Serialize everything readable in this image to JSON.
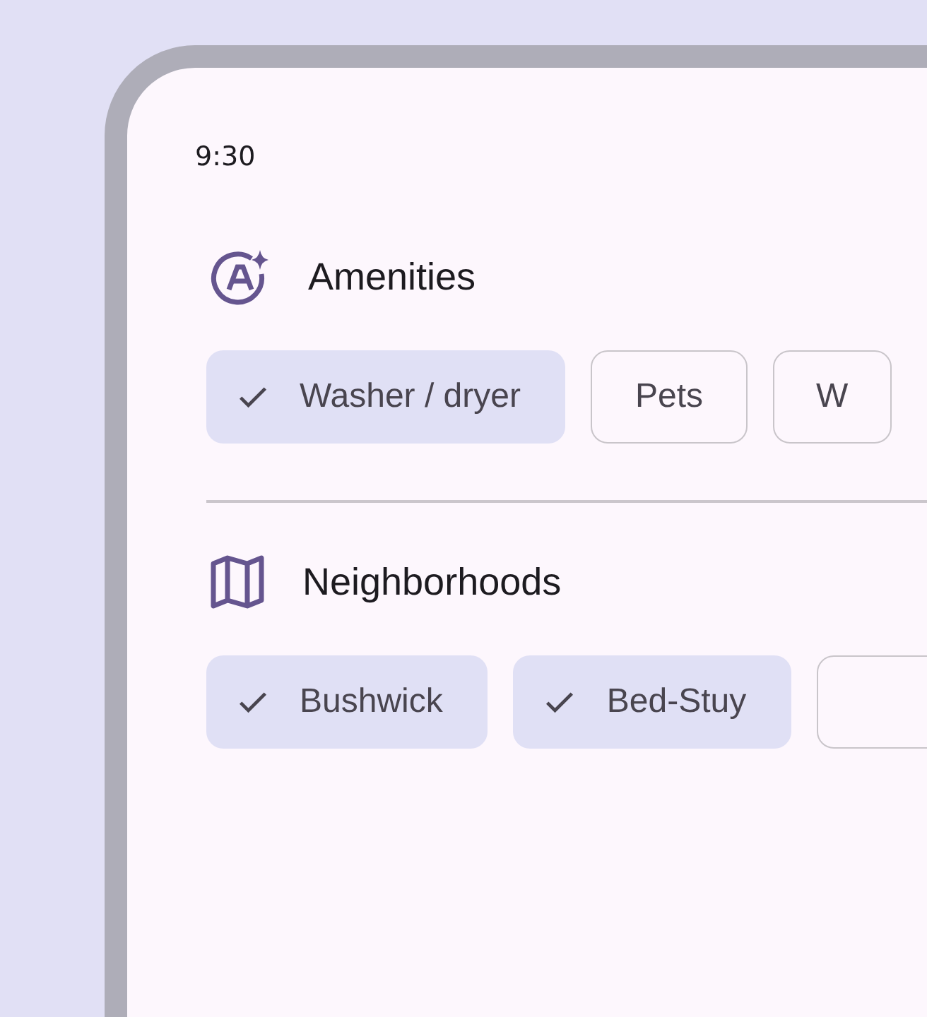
{
  "status_bar": {
    "time": "9:30"
  },
  "sections": [
    {
      "kind": "amenities",
      "title": "Amenities",
      "chips": [
        {
          "label": "Washer / dryer",
          "selected": true
        },
        {
          "label": "Pets",
          "selected": false
        },
        {
          "label": "W",
          "selected": false
        }
      ]
    },
    {
      "kind": "neighborhoods",
      "title": "Neighborhoods",
      "chips": [
        {
          "label": "Bushwick",
          "selected": true
        },
        {
          "label": "Bed-Stuy",
          "selected": true
        },
        {
          "selected": false
        }
      ]
    }
  ]
}
